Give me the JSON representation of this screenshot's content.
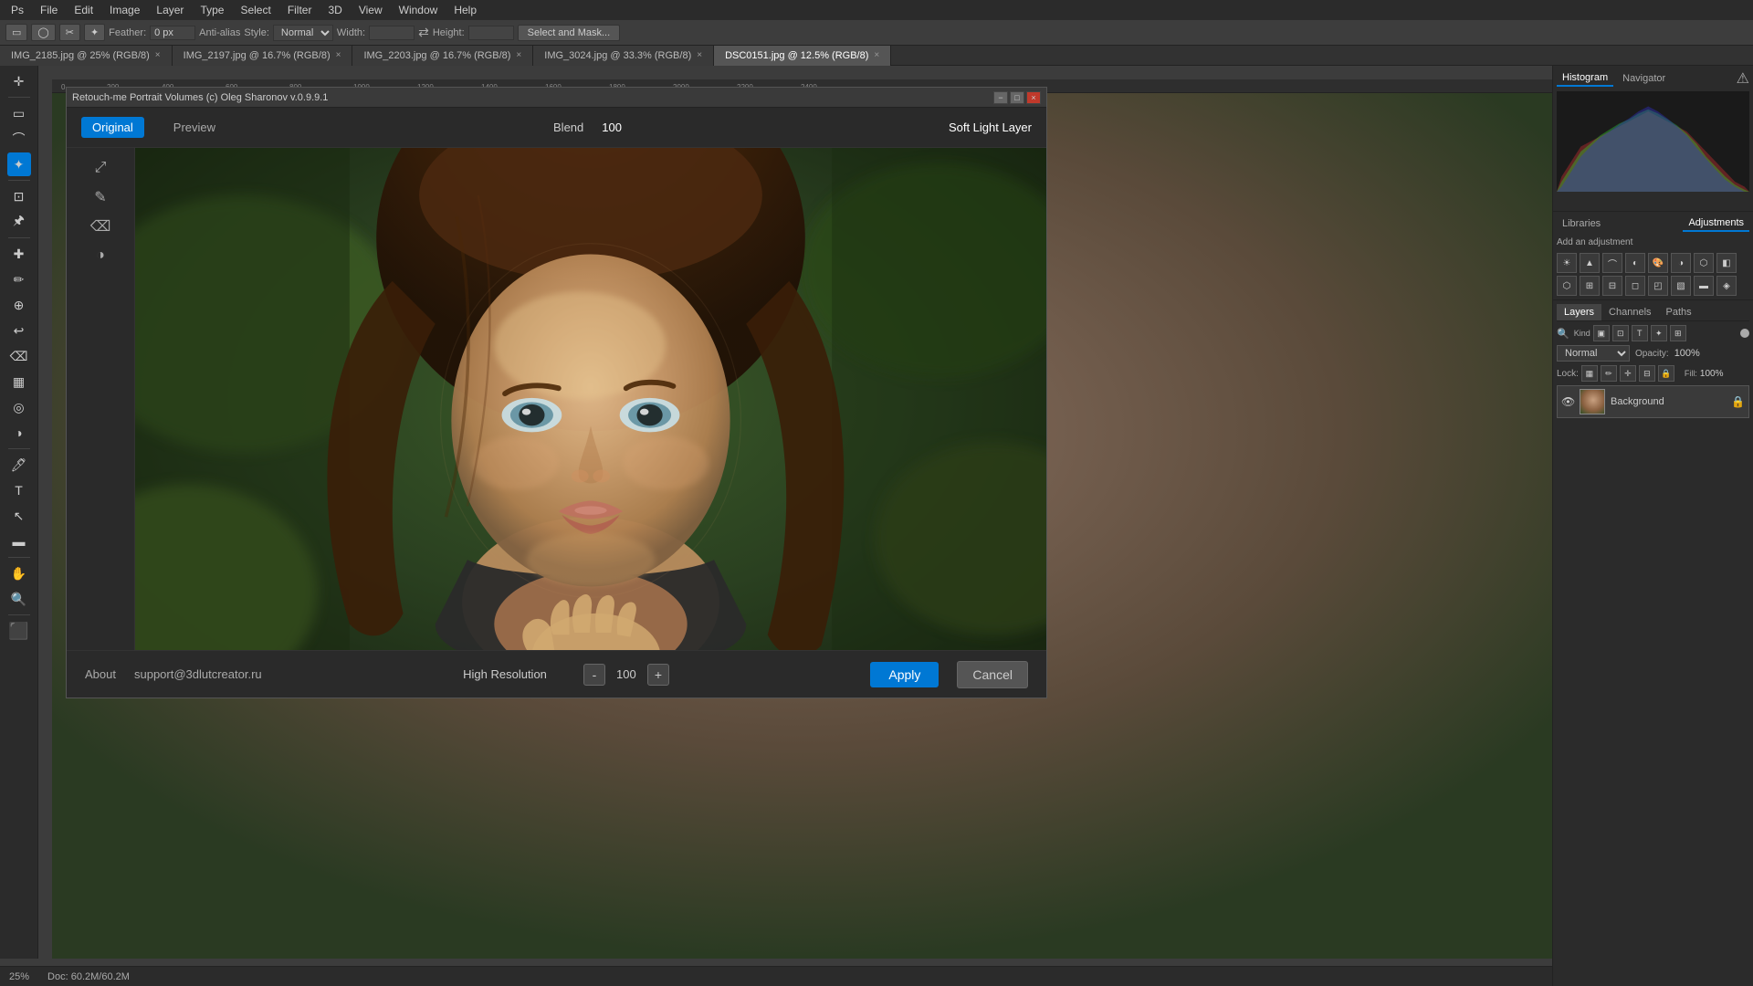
{
  "app": {
    "title": "Adobe Photoshop"
  },
  "top_menu": {
    "items": [
      "PS",
      "File",
      "Edit",
      "Image",
      "Layer",
      "Type",
      "Select",
      "Filter",
      "3D",
      "View",
      "Window",
      "Help"
    ]
  },
  "options_bar": {
    "feather_label": "Feather:",
    "feather_value": "0 px",
    "anti_alias_label": "Anti-alias",
    "style_label": "Style:",
    "style_value": "Normal",
    "width_label": "Width:",
    "height_label": "Height:",
    "select_mask_btn": "Select and Mask..."
  },
  "tabs": [
    {
      "label": "IMG_2185.jpg @ 25% (RGB/8)",
      "active": false
    },
    {
      "label": "IMG_2197.jpg @ 16.7% (RGB/8)",
      "active": false
    },
    {
      "label": "IMG_2203.jpg @ 16.7% (RGB/8)",
      "active": false
    },
    {
      "label": "IMG_3024.jpg @ 33.3% (RGB/8)",
      "active": false
    },
    {
      "label": "DSC0151.jpg @ 12.5% (RGB/8)",
      "active": true
    }
  ],
  "right_panel": {
    "histogram_tabs": [
      "Histogram",
      "Navigator"
    ],
    "adjustment_tabs": [
      "Libraries",
      "Adjustments"
    ],
    "add_adjustment_label": "Add an adjustment",
    "layers_tabs": [
      "Layers",
      "Channels",
      "Paths"
    ],
    "layers": {
      "blend_mode": "Normal",
      "opacity_label": "Opacity:",
      "opacity_value": "100%",
      "fill_label": "Fill:",
      "fill_value": "100%",
      "lock_label": "Lock:",
      "items": [
        {
          "name": "Background",
          "visible": true,
          "locked": true
        }
      ]
    }
  },
  "plugin_dialog": {
    "title": "Retouch-me Portrait Volumes (c) Oleg Sharonov v.0.9.9.1",
    "tabs": [
      "Original",
      "Preview"
    ],
    "active_tab": "Original",
    "blend_label": "Blend",
    "blend_value": "100",
    "layer_label": "Soft Light Layer",
    "about_label": "About",
    "support_email": "support@3dlutcreator.ru",
    "resolution_label": "High Resolution",
    "zoom_minus": "-",
    "zoom_value": "100",
    "zoom_plus": "+",
    "apply_label": "Apply",
    "cancel_label": "Cancel",
    "tools": [
      "⤢",
      "✎",
      "⌫",
      "◑"
    ]
  },
  "status_bar": {
    "zoom": "25%",
    "doc_size": "Doc: 60.2M/60.2M"
  }
}
